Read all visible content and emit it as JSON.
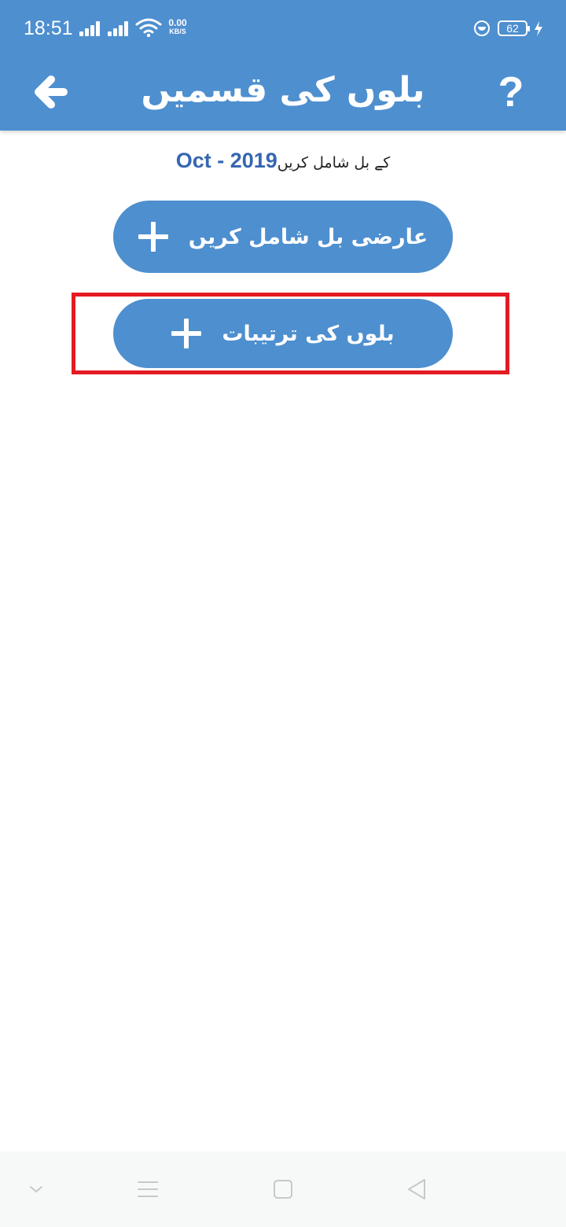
{
  "status_bar": {
    "time": "18:51",
    "net_speed_value": "0.00",
    "net_speed_unit": "KB/S",
    "battery_level": "62",
    "icons": [
      "signal-icon",
      "signal-icon",
      "wifi-icon",
      "app-notification-icon",
      "battery-icon",
      "charging-icon"
    ]
  },
  "app_bar": {
    "title": "بلوں کی قسمیں",
    "help_label": "?",
    "back_icon": "arrow-left-icon"
  },
  "content": {
    "period": "Oct - 2019",
    "period_suffix": "کے بل شامل کریں",
    "buttons": [
      {
        "label": "عارضی بل شامل کریں",
        "icon": "plus-icon"
      },
      {
        "label": "بلوں کی ترتیبات",
        "icon": "plus-icon"
      }
    ]
  },
  "colors": {
    "primary": "#4e8fcf",
    "period_text": "#3566b0",
    "highlight": "#e31b23"
  },
  "nav_bar": {
    "icons": [
      "chevron-down-icon",
      "menu-icon",
      "home-icon",
      "back-triangle-icon"
    ]
  }
}
